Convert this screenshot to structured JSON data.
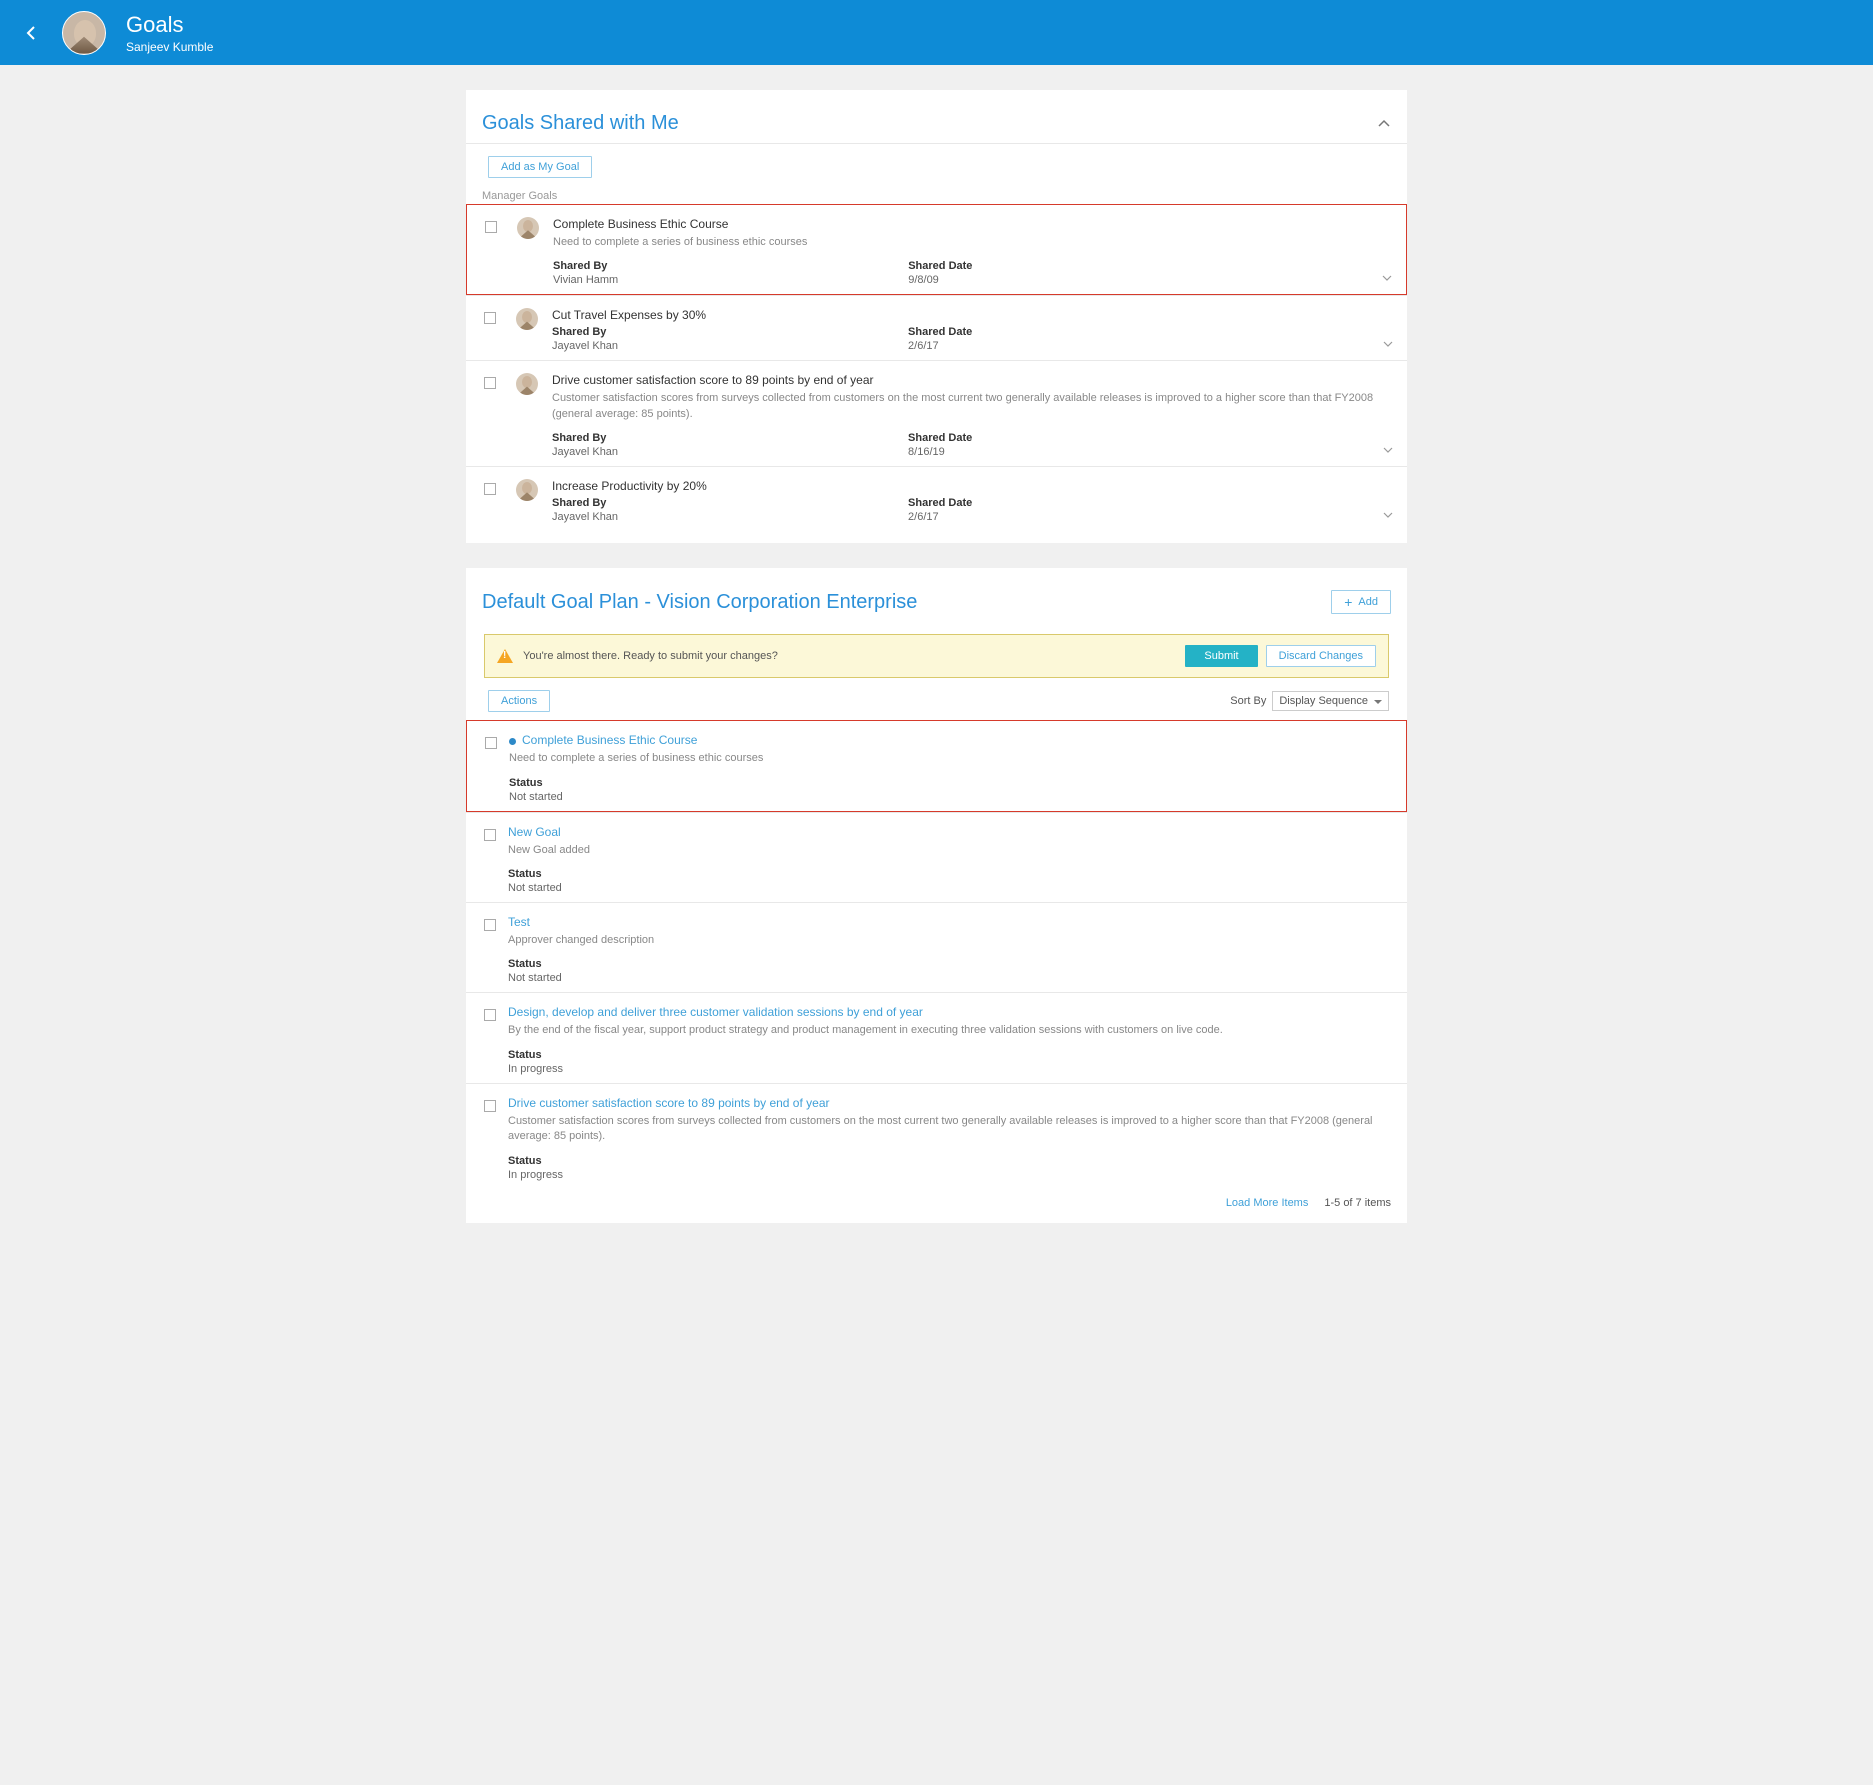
{
  "header": {
    "title": "Goals",
    "user": "Sanjeev Kumble"
  },
  "shared": {
    "title": "Goals Shared with Me",
    "add_button": "Add as My Goal",
    "group_label": "Manager Goals",
    "labels": {
      "shared_by": "Shared By",
      "shared_date": "Shared Date"
    },
    "items": [
      {
        "title": "Complete Business Ethic Course",
        "desc": "Need to complete a series of business ethic courses",
        "by": "Vivian Hamm",
        "date": "9/8/09",
        "highlight": true
      },
      {
        "title": "Cut Travel Expenses by 30%",
        "desc": "",
        "by": "Jayavel Khan",
        "date": "2/6/17",
        "highlight": false
      },
      {
        "title": "Drive customer satisfaction score to 89 points by end of year",
        "desc": "Customer satisfaction scores from surveys collected from customers on the most current two generally available releases is improved to a higher score than that FY2008 (general average: 85 points).",
        "by": "Jayavel Khan",
        "date": "8/16/19",
        "highlight": false
      },
      {
        "title": "Increase Productivity by 20%",
        "desc": "",
        "by": "Jayavel Khan",
        "date": "2/6/17",
        "highlight": false
      }
    ]
  },
  "plan": {
    "title": "Default Goal Plan - Vision Corporation Enterprise",
    "add_button": "Add",
    "banner": {
      "text": "You're almost there. Ready to submit your changes?",
      "submit": "Submit",
      "discard": "Discard Changes"
    },
    "actions_button": "Actions",
    "sort_label": "Sort By",
    "sort_value": "Display Sequence",
    "status_label": "Status",
    "items": [
      {
        "title": "Complete Business Ethic Course",
        "desc": "Need to complete a series of business ethic courses",
        "status": "Not started",
        "highlight": true,
        "dot": true
      },
      {
        "title": "New Goal",
        "desc": "New Goal added",
        "status": "Not started",
        "highlight": false,
        "dot": false
      },
      {
        "title": "Test",
        "desc": "Approver changed description",
        "status": "Not started",
        "highlight": false,
        "dot": false
      },
      {
        "title": "Design, develop and deliver three customer validation sessions by end of year",
        "desc": "By the end of the fiscal year, support product strategy and product management in executing three validation sessions with customers on live code.",
        "status": "In progress",
        "highlight": false,
        "dot": false
      },
      {
        "title": "Drive customer satisfaction score to 89 points by end of year",
        "desc": "Customer satisfaction scores from surveys collected from customers on the most current two generally available releases is improved to a higher score than that FY2008 (general average: 85 points).",
        "status": "In progress",
        "highlight": false,
        "dot": false
      }
    ],
    "footer": {
      "load_more": "Load More Items",
      "count": "1-5 of 7 items"
    }
  }
}
